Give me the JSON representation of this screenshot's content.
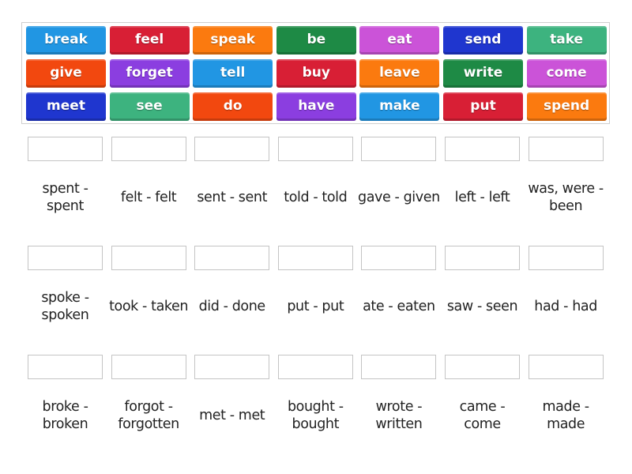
{
  "tiles": [
    {
      "label": "break",
      "color": "#2196e3"
    },
    {
      "label": "feel",
      "color": "#d81f35"
    },
    {
      "label": "speak",
      "color": "#fb7a0f"
    },
    {
      "label": "be",
      "color": "#1e8a45"
    },
    {
      "label": "eat",
      "color": "#cb53d8"
    },
    {
      "label": "send",
      "color": "#1f36cf"
    },
    {
      "label": "take",
      "color": "#3db37f"
    },
    {
      "label": "give",
      "color": "#f2480f"
    },
    {
      "label": "forget",
      "color": "#8b3ee0"
    },
    {
      "label": "tell",
      "color": "#2196e3"
    },
    {
      "label": "buy",
      "color": "#d81f35"
    },
    {
      "label": "leave",
      "color": "#fb7a0f"
    },
    {
      "label": "write",
      "color": "#1e8a45"
    },
    {
      "label": "come",
      "color": "#cb53d8"
    },
    {
      "label": "meet",
      "color": "#1f36cf"
    },
    {
      "label": "see",
      "color": "#3db37f"
    },
    {
      "label": "do",
      "color": "#f2480f"
    },
    {
      "label": "have",
      "color": "#8b3ee0"
    },
    {
      "label": "make",
      "color": "#2196e3"
    },
    {
      "label": "put",
      "color": "#d81f35"
    },
    {
      "label": "spend",
      "color": "#fb7a0f"
    }
  ],
  "targets": [
    {
      "text": "spent - spent",
      "value": ""
    },
    {
      "text": "felt - felt",
      "value": ""
    },
    {
      "text": "sent - sent",
      "value": ""
    },
    {
      "text": "told - told",
      "value": ""
    },
    {
      "text": "gave - given",
      "value": ""
    },
    {
      "text": "left - left",
      "value": ""
    },
    {
      "text": "was, were - been",
      "value": ""
    },
    {
      "text": "spoke - spoken",
      "value": ""
    },
    {
      "text": "took - taken",
      "value": ""
    },
    {
      "text": "did - done",
      "value": ""
    },
    {
      "text": "put - put",
      "value": ""
    },
    {
      "text": "ate - eaten",
      "value": ""
    },
    {
      "text": "saw - seen",
      "value": ""
    },
    {
      "text": "had - had",
      "value": ""
    },
    {
      "text": "broke - broken",
      "value": ""
    },
    {
      "text": "forgot - forgotten",
      "value": ""
    },
    {
      "text": "met - met",
      "value": ""
    },
    {
      "text": "bought - bought",
      "value": ""
    },
    {
      "text": "wrote - written",
      "value": ""
    },
    {
      "text": "came - come",
      "value": ""
    },
    {
      "text": "made - made",
      "value": ""
    }
  ]
}
